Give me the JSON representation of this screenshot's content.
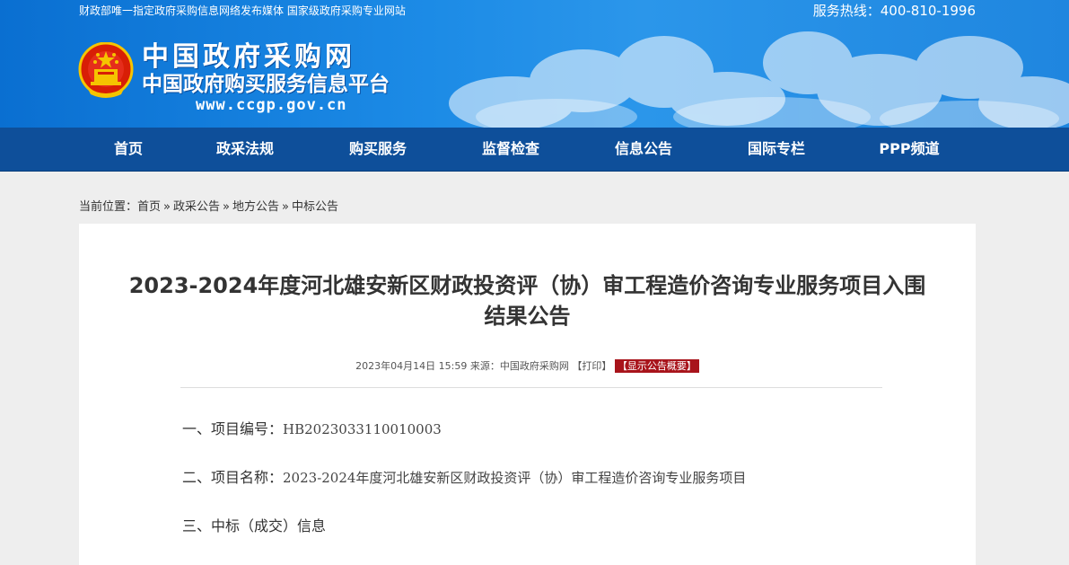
{
  "topbar": {
    "left_text": "财政部唯一指定政府采购信息网络发布媒体 国家级政府采购专业网站",
    "hotline": "服务热线：400-810-1996"
  },
  "logo": {
    "title": "中国政府采购网",
    "subtitle": "中国政府购买服务信息平台",
    "url": "www.ccgp.gov.cn",
    "icon": "national-emblem-icon"
  },
  "nav": {
    "items": [
      "首页",
      "政采法规",
      "购买服务",
      "监督检查",
      "信息公告",
      "国际专栏",
      "PPP频道"
    ]
  },
  "breadcrumb": {
    "prefix": "当前位置：",
    "items": [
      "首页",
      "政采公告",
      "地方公告",
      "中标公告"
    ],
    "separator": "»"
  },
  "article": {
    "title_line1": "2023-2024年度河北雄安新区财政投资评（协）审工程造价咨询专业服务项目入围",
    "title_line2": "结果公告",
    "date": "2023年04月14日 15:59",
    "source": "来源：中国政府采购网",
    "print_label": "【打印】",
    "summary_label": "【显示公告概要】",
    "sections": [
      {
        "label": "一、项目编号：",
        "value": "HB2023033110010003"
      },
      {
        "label": "二、项目名称：",
        "value": "2023-2024年度河北雄安新区财政投资评（协）审工程造价咨询专业服务项目"
      },
      {
        "label": "三、中标（成交）信息",
        "value": ""
      }
    ]
  },
  "colors": {
    "header_blue": "#1c8be6",
    "nav_blue": "#0e4f9a",
    "summary_red": "#a8141b"
  }
}
